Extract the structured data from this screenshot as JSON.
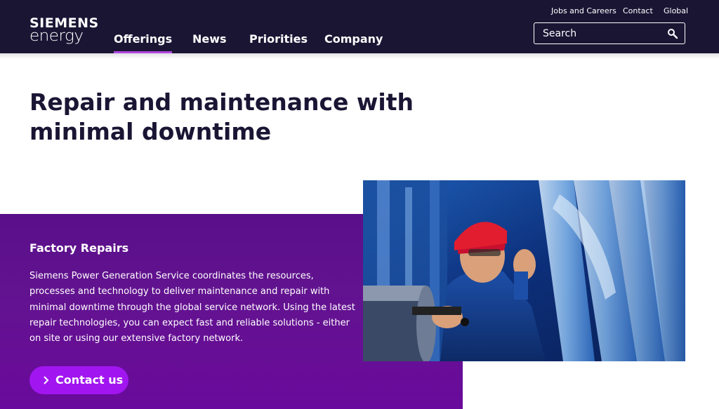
{
  "brand": {
    "line1": "SIEMENS",
    "line2": "energy"
  },
  "nav": {
    "items": [
      {
        "label": "Offerings",
        "active": true
      },
      {
        "label": "News",
        "active": false
      },
      {
        "label": "Priorities",
        "active": false
      },
      {
        "label": "Company",
        "active": false
      }
    ]
  },
  "utility": {
    "jobs": "Jobs and Careers",
    "contact": "Contact",
    "global": "Global"
  },
  "search": {
    "placeholder": "Search",
    "icon": "search-icon"
  },
  "page": {
    "title": "Repair and maintenance with minimal downtime"
  },
  "panel": {
    "heading": "Factory Repairs",
    "body": "Siemens Power Generation Service coordinates the resources, processes and technology to deliver maintenance and repair with minimal downtime through the global service network. Using the latest repair technologies, you can expect fast and reliable solutions - either on site or using our extensive factory network.",
    "cta": "Contact us",
    "cta_icon": "chevron-right-icon"
  },
  "colors": {
    "header_bg": "#1b1534",
    "accent": "#af47e0",
    "panel_bg": "#5f1190",
    "button_bg": "#a116f0"
  }
}
